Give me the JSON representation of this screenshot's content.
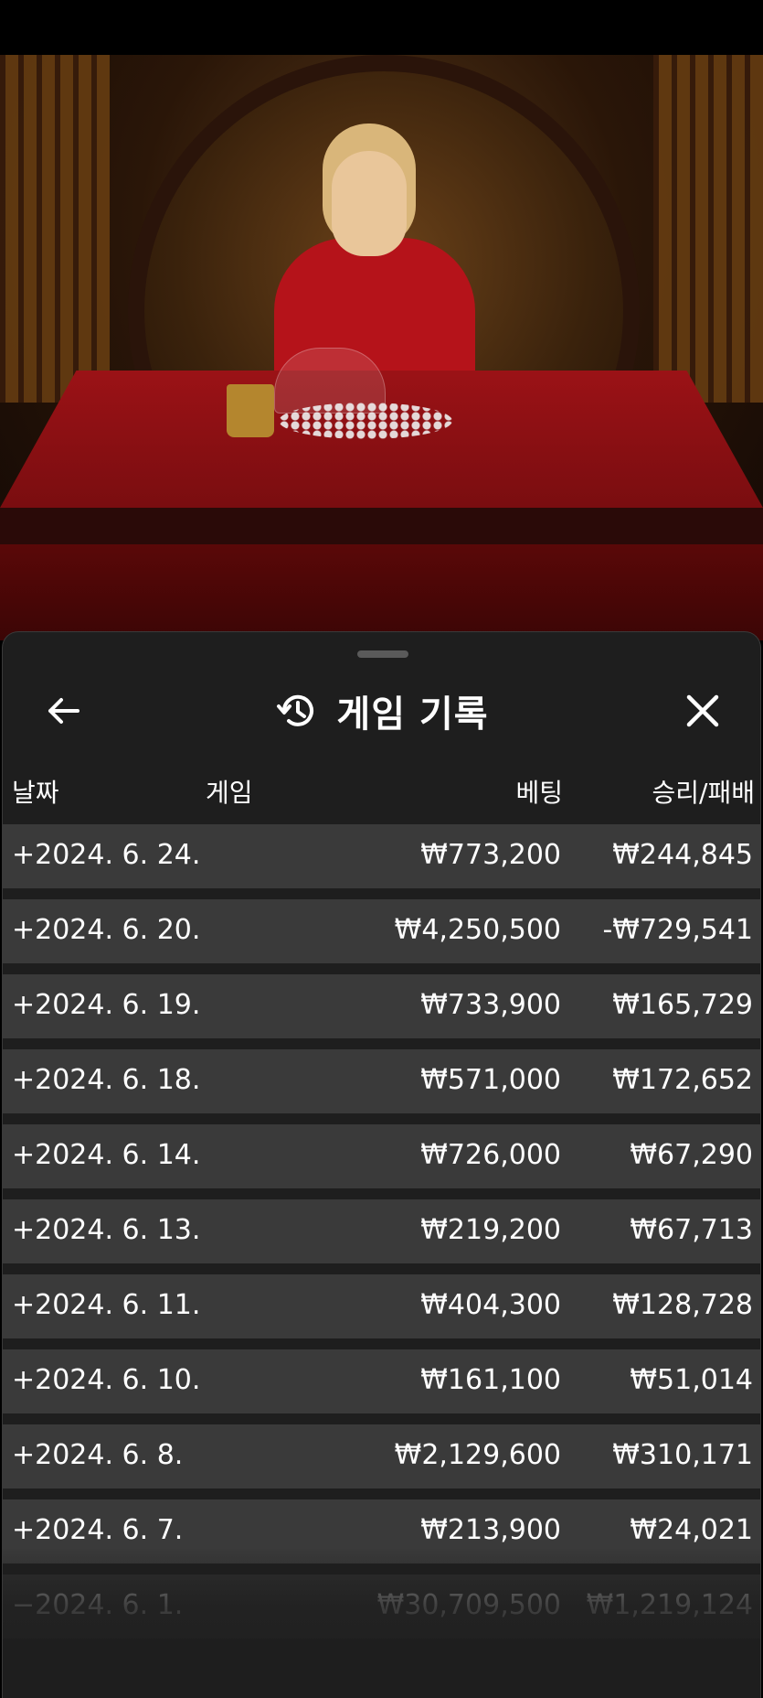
{
  "header": {
    "title": "게임 기록",
    "back_icon": "arrow-left-icon",
    "history_icon": "history-icon",
    "close_icon": "close-icon"
  },
  "columns": {
    "date": "날짜",
    "game": "게임",
    "bet": "베팅",
    "win_loss": "승리/패배"
  },
  "rows": [
    {
      "date": "+2024. 6. 24.",
      "bet": "₩773,200",
      "result": "₩244,845"
    },
    {
      "date": "+2024. 6. 20.",
      "bet": "₩4,250,500",
      "result": "-₩729,541"
    },
    {
      "date": "+2024. 6. 19.",
      "bet": "₩733,900",
      "result": "₩165,729"
    },
    {
      "date": "+2024. 6. 18.",
      "bet": "₩571,000",
      "result": "₩172,652"
    },
    {
      "date": "+2024. 6. 14.",
      "bet": "₩726,000",
      "result": "₩67,290"
    },
    {
      "date": "+2024. 6. 13.",
      "bet": "₩219,200",
      "result": "₩67,713"
    },
    {
      "date": "+2024. 6. 11.",
      "bet": "₩404,300",
      "result": "₩128,728"
    },
    {
      "date": "+2024. 6. 10.",
      "bet": "₩161,100",
      "result": "₩51,014"
    },
    {
      "date": "+2024. 6. 8.",
      "bet": "₩2,129,600",
      "result": "₩310,171"
    },
    {
      "date": "+2024. 6. 7.",
      "bet": "₩213,900",
      "result": "₩24,021"
    },
    {
      "date": "−2024. 6. 1.",
      "bet": "₩30,709,500",
      "result": "₩1,219,124"
    }
  ],
  "colors": {
    "sheet_bg": "#1e1e1e",
    "row_bg": "#3a3a3a",
    "table_felt": "#9b1216"
  }
}
